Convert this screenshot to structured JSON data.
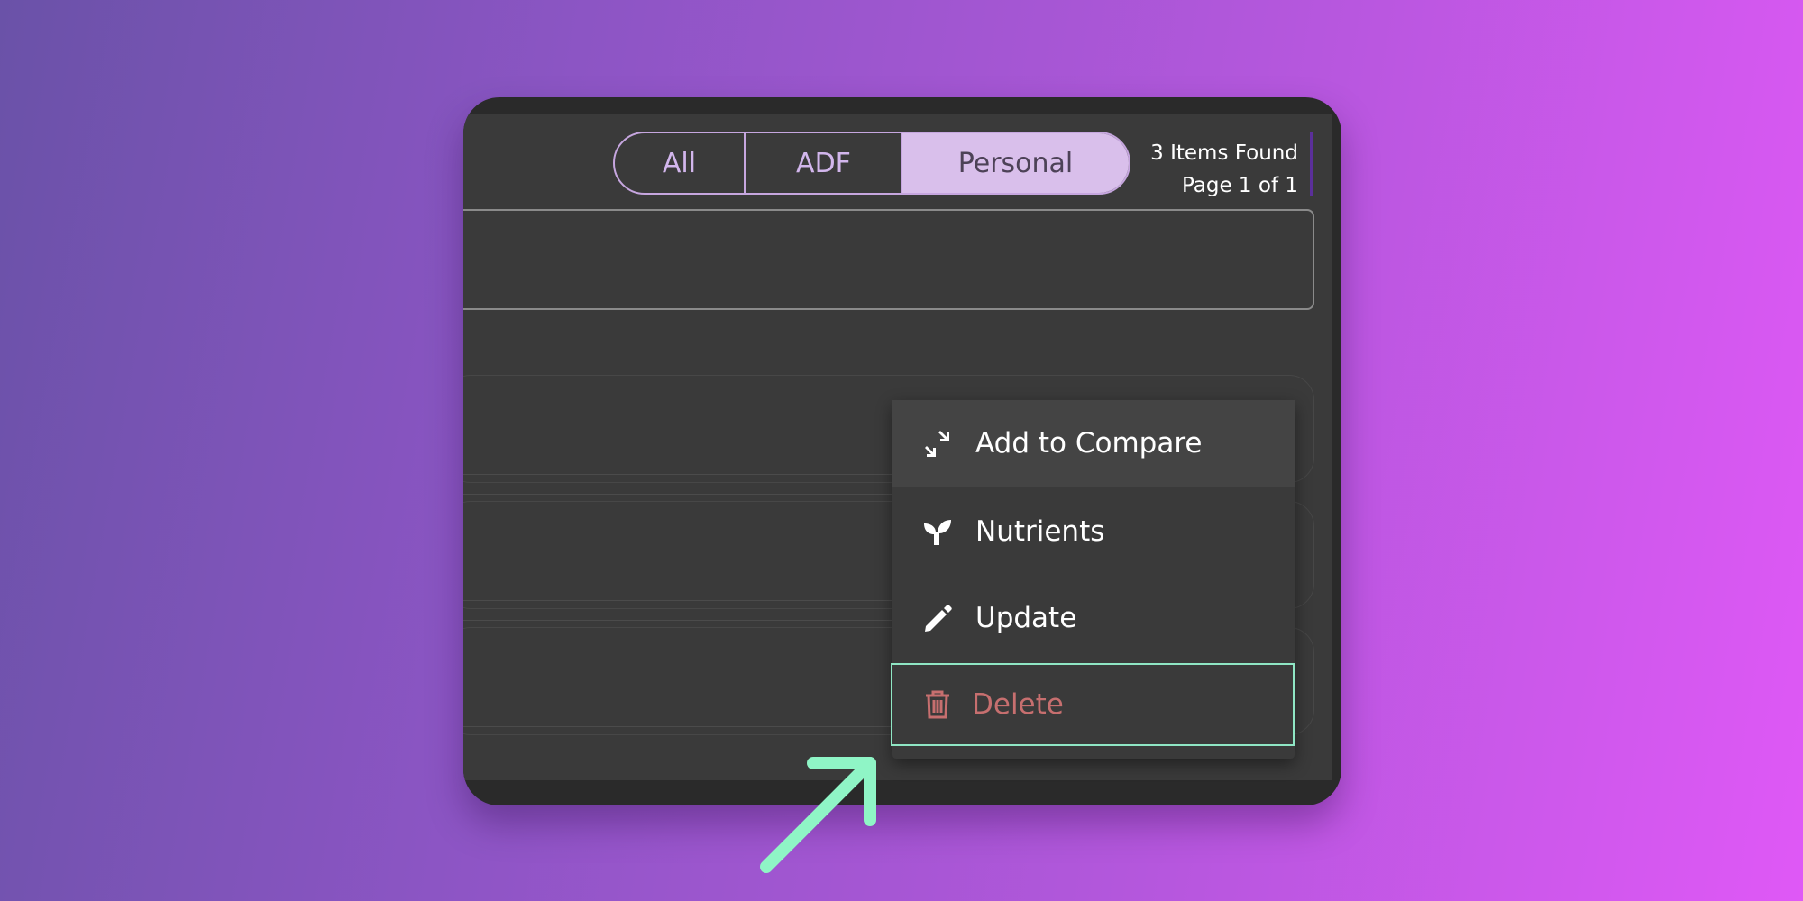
{
  "tabs": {
    "all": "All",
    "adf": "ADF",
    "personal": "Personal",
    "active": "Personal"
  },
  "results": {
    "count_text": "3 Items Found",
    "page_text": "Page 1 of 1"
  },
  "context_menu": {
    "items": [
      {
        "label": "Add to Compare",
        "icon": "compare-arrows-icon"
      },
      {
        "label": "Nutrients",
        "icon": "sprout-icon"
      },
      {
        "label": "Update",
        "icon": "pencil-icon"
      },
      {
        "label": "Delete",
        "icon": "trash-icon"
      }
    ]
  },
  "colors": {
    "accent_tab": "#d9bfeb",
    "delete_text": "#c76f6f",
    "focus_outline": "#8fe6c4",
    "arrow": "#8ff5c6"
  }
}
